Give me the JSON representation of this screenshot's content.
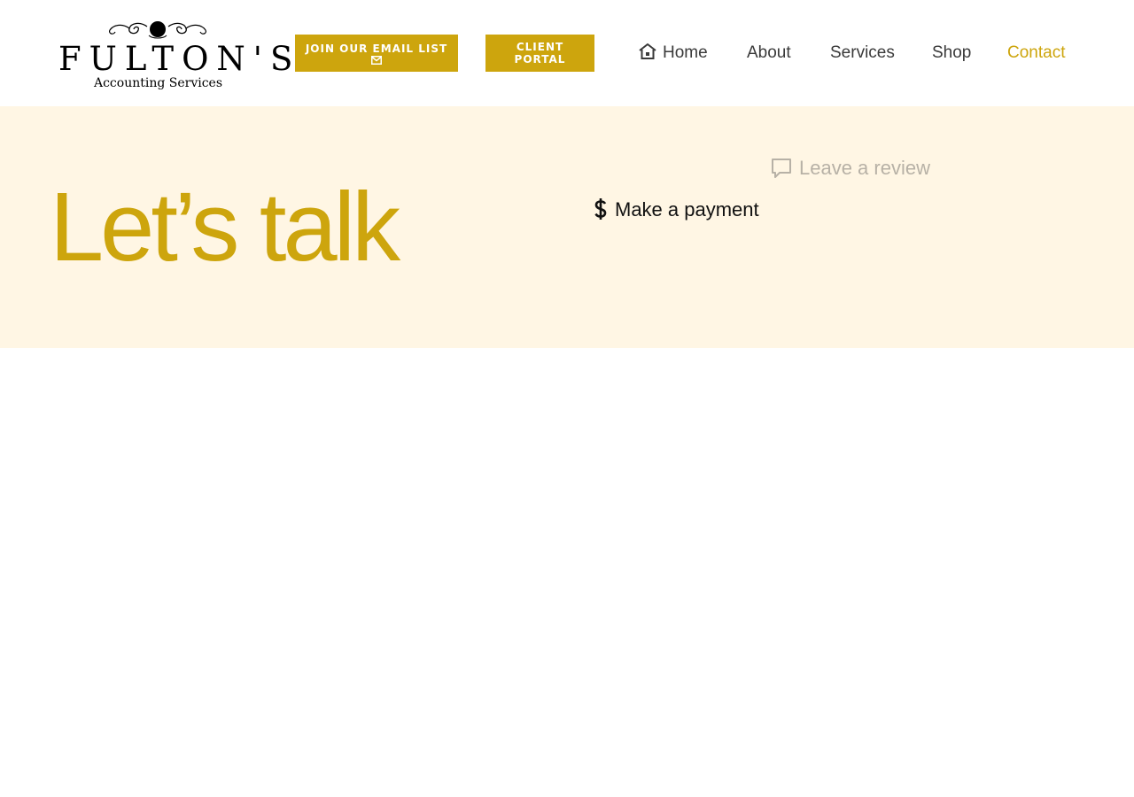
{
  "brand": {
    "name": "FULTON'S",
    "tagline": "Accounting Services",
    "color": "#cda50d"
  },
  "header": {
    "email_button_label": "JOIN OUR EMAIL LIST",
    "email_button_icon": "envelope-icon",
    "portal_button_line1": "CLIENT",
    "portal_button_line2": "PORTAL"
  },
  "nav": {
    "items": [
      {
        "label": "Home",
        "icon": "home-icon",
        "active": false
      },
      {
        "label": "About",
        "active": false
      },
      {
        "label": "Services",
        "active": false
      },
      {
        "label": "Shop",
        "active": false
      },
      {
        "label": "Contact",
        "active": true
      }
    ]
  },
  "hero": {
    "title": "Let’s talk",
    "background": "#fff6e4",
    "links": {
      "review": {
        "label": "Leave a review",
        "icon": "comment-icon"
      },
      "payment": {
        "label": "Make a payment",
        "icon": "dollar-icon"
      }
    }
  }
}
